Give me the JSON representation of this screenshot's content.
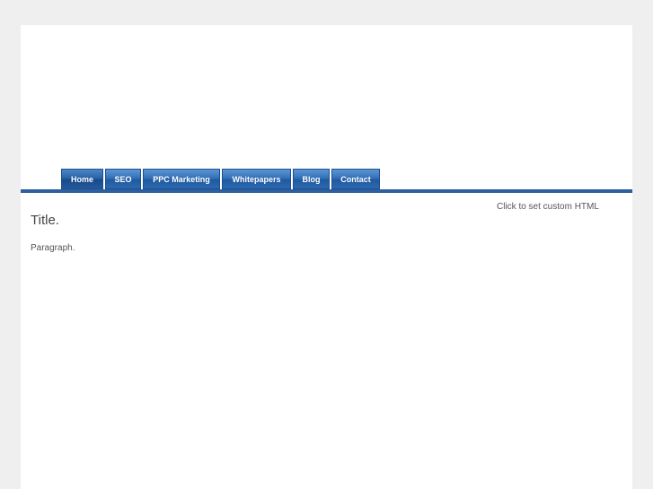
{
  "nav": {
    "items": [
      {
        "label": "Home"
      },
      {
        "label": "SEO"
      },
      {
        "label": "PPC Marketing"
      },
      {
        "label": "Whitepapers"
      },
      {
        "label": "Blog"
      },
      {
        "label": "Contact"
      }
    ]
  },
  "sidebar": {
    "custom_html_label": "Click to set custom HTML"
  },
  "content": {
    "title": "Title.",
    "paragraph": "Paragraph."
  },
  "colors": {
    "background": "#efefef",
    "page": "#ffffff",
    "nav_button": "#2d69b0",
    "divider": "#2d5fa0"
  }
}
